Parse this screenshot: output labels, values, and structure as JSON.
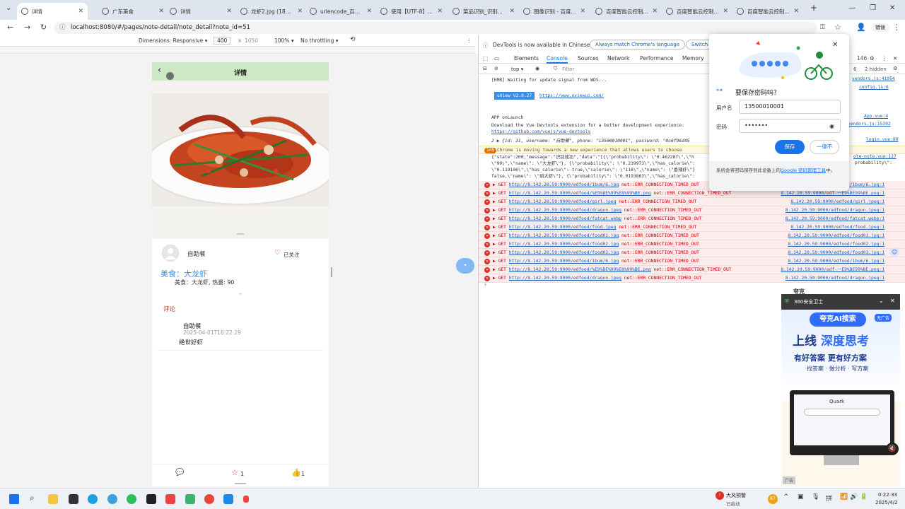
{
  "browser": {
    "tabs": [
      {
        "title": "详情",
        "active": true
      },
      {
        "title": "广东美食"
      },
      {
        "title": "详情"
      },
      {
        "title": "龙虾2.jpg (1879..."
      },
      {
        "title": "urlencode_百度..."
      },
      {
        "title": "使用【UTF-8】..."
      },
      {
        "title": "菜品识别_识别..."
      },
      {
        "title": "图像识别 - 百度..."
      },
      {
        "title": "百度智能云控制..."
      },
      {
        "title": "百度智能云控制..."
      },
      {
        "title": "百度智能云控制..."
      }
    ],
    "new_tab": "+",
    "url": "localhost:8080/#/pages/note-detail/note_detail?note_id=51",
    "profile_label": "错误"
  },
  "device_toolbar": {
    "dimensions": "Dimensions: Responsive ▾",
    "width": "400",
    "height": "1050",
    "zoom": "100% ▾",
    "throttle": "No throttling ▾"
  },
  "app": {
    "header_title": "详情",
    "author_name": "自助餐",
    "follow_label": "已关注",
    "food_title": "美食：大龙虾",
    "food_info": "美食：大龙虾, 热量: 90",
    "comments_title": "评论",
    "comment": {
      "author": "自助餐",
      "time": "2025-04-01T16:22:29",
      "text": "绝世好虾"
    },
    "star_count": "1",
    "like_count": "1"
  },
  "devtools": {
    "notice": "DevTools is now available in Chinese!",
    "notice_btn1": "Always match Chrome's language",
    "notice_btn2": "Switch t",
    "tabs": [
      "Elements",
      "Console",
      "Sources",
      "Network",
      "Performance",
      "Memory"
    ],
    "warn_count": "146",
    "hidden_count": "6",
    "hidden_label": "2 hidden",
    "filter_context": "top ▾",
    "filter_placeholder": "Filter",
    "console": {
      "hmr": "[HMR] Waiting for update signal from WDS...",
      "hmr_src": "vendors.js:41954",
      "config_src": "config.js:6",
      "uview": "uView V2.0.27",
      "uview_link": "https://www.uviewui.com/",
      "app_launch": "APP onLaunch",
      "app_src": "App.vue:4",
      "vue_dev": "Download the Vue Devtools extension for a better development experience:",
      "vue_link": "https://github.com/vuejs/vue-devtools",
      "vue_src": "vendors.js:15392",
      "login_line": "2  ▶ {id: 31, username: \"自助餐\", phone: \"13500010001\", password: \"0c6f96d45",
      "login_src": "login.vue:80",
      "badge": "145",
      "chrome_msg": "Chrome is moving towards a new experience that allows users to choose",
      "json1": "{\"state\":200,\"message\":\"识别成功\",\"data\":\"[{\\\"probability\\\": \\\"0.462287\\\",\\\"h",
      "json2": "\\\"90\\\",\\\"name\\\": \\\"大龙虾\\\"}, {\\\"probability\\\": \\\"0.239973\\\",\\\"has_calorie\\\":",
      "json3": "\\\"0.119106\\\",\\\"has_calorie\\\": true,\\\"calorie\\\": \\\"116\\\",\\\"name\\\": \\\"香辣虾\\\"}",
      "json4": "false,\\\"name\\\": \\\"焖大虾\\\"}, {\\\"probability\\\": \\\"0.0193863\\\",\\\"has_calorie\\\":",
      "json_src": "ote-note.vue:127",
      "json_src2": "probability\\\":",
      "errors": [
        {
          "url": "http://8.142.20.59:9000/edfood/1bum/6.jpg",
          "msg": "net::ERR_CONNECTION_TIMED_OUT",
          "src": "8.142.20.59:9000/edfood/1bum/6.jpg:1"
        },
        {
          "url": "http://8.142.20.59:9000/edfood/%E9%BE%99%E8%99%BE.png",
          "msg": "net::ERR_CONNECTION_TIMED_OUT",
          "src": "8.142.20.59:9000/edf-一E9%BE99%BE.png:1"
        },
        {
          "url": "http://8.142.20.59:9000/edfood/girl.jpeg",
          "msg": "net::ERR_CONNECTION_TIMED_OUT",
          "src": "8.142.20.59:9000/edfood/girl.jpeg:1"
        },
        {
          "url": "http://8.142.20.59:9000/edfood/dragon.jpeg",
          "msg": "net::ERR_CONNECTION_TIMED_OUT",
          "src": "8.142.20.59:9000/edfood/dragon.jpeg:1"
        },
        {
          "url": "http://8.142.20.59:9000/edfood/fatcat.webp",
          "msg": "net::ERR_CONNECTION_TIMED_OUT",
          "src": "8.142.20.59:9000/edfood/fatcat.webp:1"
        },
        {
          "url": "http://8.142.20.59:9000/edfood/food.jpeg",
          "msg": "net::ERR_CONNECTION_TIMED_OUT",
          "src": "8.142.20.59:9000/edfood/food.jpeg:1"
        },
        {
          "url": "http://8.142.20.59:9000/edfood/food01.jpg",
          "msg": "net::ERR_CONNECTION_TIMED_OUT",
          "src": "8.142.20.59:9000/edfood/food01.jpg:1"
        },
        {
          "url": "http://8.142.20.59:9000/edfood/food02.jpg",
          "msg": "net::ERR_CONNECTION_TIMED_OUT",
          "src": "8.142.20.59:9000/edfood/food02.jpg:1"
        },
        {
          "url": "http://8.142.20.59:9000/edfood/food03.jpg",
          "msg": "net::ERR_CONNECTION_TIMED_OUT",
          "src": "8.142.20.59:9000/edfood/food03.jpg:1"
        },
        {
          "url": "http://8.142.20.59:9000/edfood/1bum/6.jpg",
          "msg": "net::ERR_CONNECTION_TIMED_OUT",
          "src": "8.142.20.59:9000/edfood/1bum/6.jpg:1"
        },
        {
          "url": "http://8.142.20.59:9000/edfood/%E9%BE%99%E8%99%BE.png",
          "msg": "net::ERR_CONNECTION_TIMED_OUT",
          "src": "8.142.20.59:9000/edf-一E9%BE99%BE.png:1"
        },
        {
          "url": "http://8.142.20.59:9000/edfood/dragon.jpeg",
          "msg": "net::ERR_CONNECTION_TIMED_OUT",
          "src": "8.142.20.59:9000/edfood/dragon.jpeg:1"
        }
      ]
    }
  },
  "password_popup": {
    "title": "要保存密码吗？",
    "username_label": "用户名",
    "username_value": "13500010001",
    "password_label": "密码",
    "password_value": "•••••••",
    "save_button": "保存",
    "never_button": "一律不",
    "footer": "系统会将密码保存到此设备上的",
    "footer_link": "Google 密码管理工具",
    "footer_end": "中。"
  },
  "ad": {
    "header": "360安全卫士",
    "brand": "夸克AI搜索",
    "badge": "无广告",
    "headline1": "上线",
    "headline2": "深度思考",
    "sub1": "有好答案 更有好方案",
    "sub2": "找答案 · 做分析 · 写方案",
    "screen_text": "Quark",
    "ad_tag": "广告",
    "top_label": "夸克"
  },
  "taskbar": {
    "weather_title": "大风预警",
    "weather_sub": "已启动",
    "badge": "87",
    "time": "0:22:33",
    "date": "2025/4/2"
  }
}
